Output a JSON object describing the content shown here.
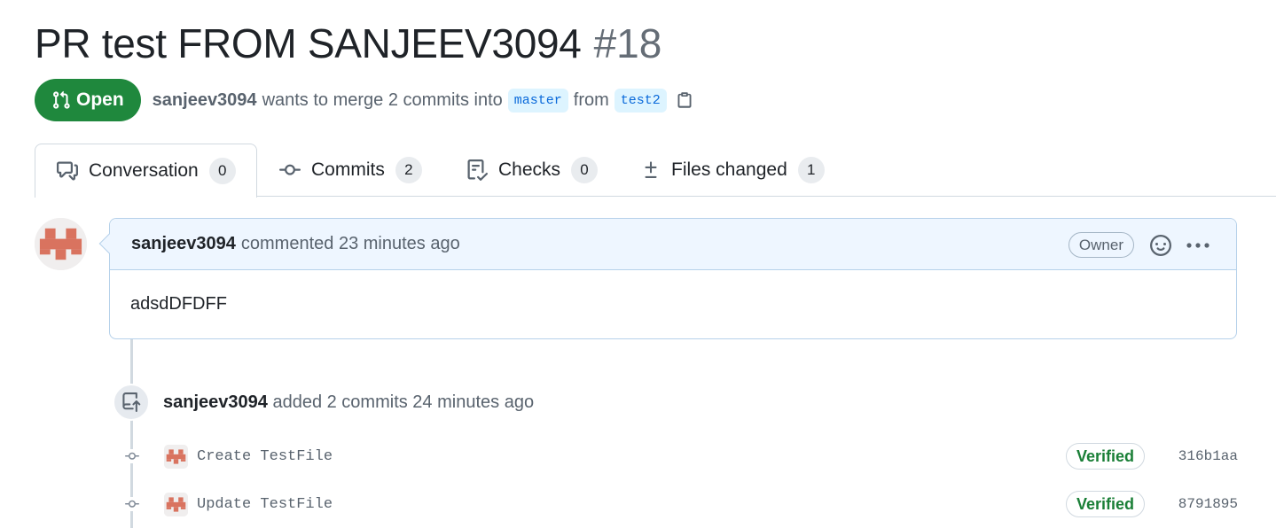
{
  "pull_request": {
    "title": "PR test FROM SANJEEV3094",
    "number": "#18",
    "state_label": "Open",
    "author": "sanjeev3094",
    "merge_text": "wants to merge 2 commits into",
    "base_branch": "master",
    "from_text": "from",
    "head_branch": "test2"
  },
  "tabs": [
    {
      "label": "Conversation",
      "count": "0",
      "icon": "comment-discussion-icon",
      "selected": true
    },
    {
      "label": "Commits",
      "count": "2",
      "icon": "git-commit-icon",
      "selected": false
    },
    {
      "label": "Checks",
      "count": "0",
      "icon": "checklist-icon",
      "selected": false
    },
    {
      "label": "Files changed",
      "count": "1",
      "icon": "diff-icon",
      "selected": false
    }
  ],
  "comment": {
    "author": "sanjeev3094",
    "action": "commented 23 minutes ago",
    "role_badge": "Owner",
    "body": "adsdDFDFF"
  },
  "commit_event": {
    "author": "sanjeev3094",
    "text": "added 2 commits 24 minutes ago"
  },
  "commits": [
    {
      "message": "Create TestFile",
      "verified_label": "Verified",
      "sha": "316b1aa"
    },
    {
      "message": "Update TestFile",
      "verified_label": "Verified",
      "sha": "8791895"
    }
  ],
  "colors": {
    "open_green": "#1f883d",
    "verified_green": "#1a7f37",
    "link_blue": "#0969da",
    "comment_header_bg": "#eef6ff",
    "avatar_red": "#d9735f"
  }
}
